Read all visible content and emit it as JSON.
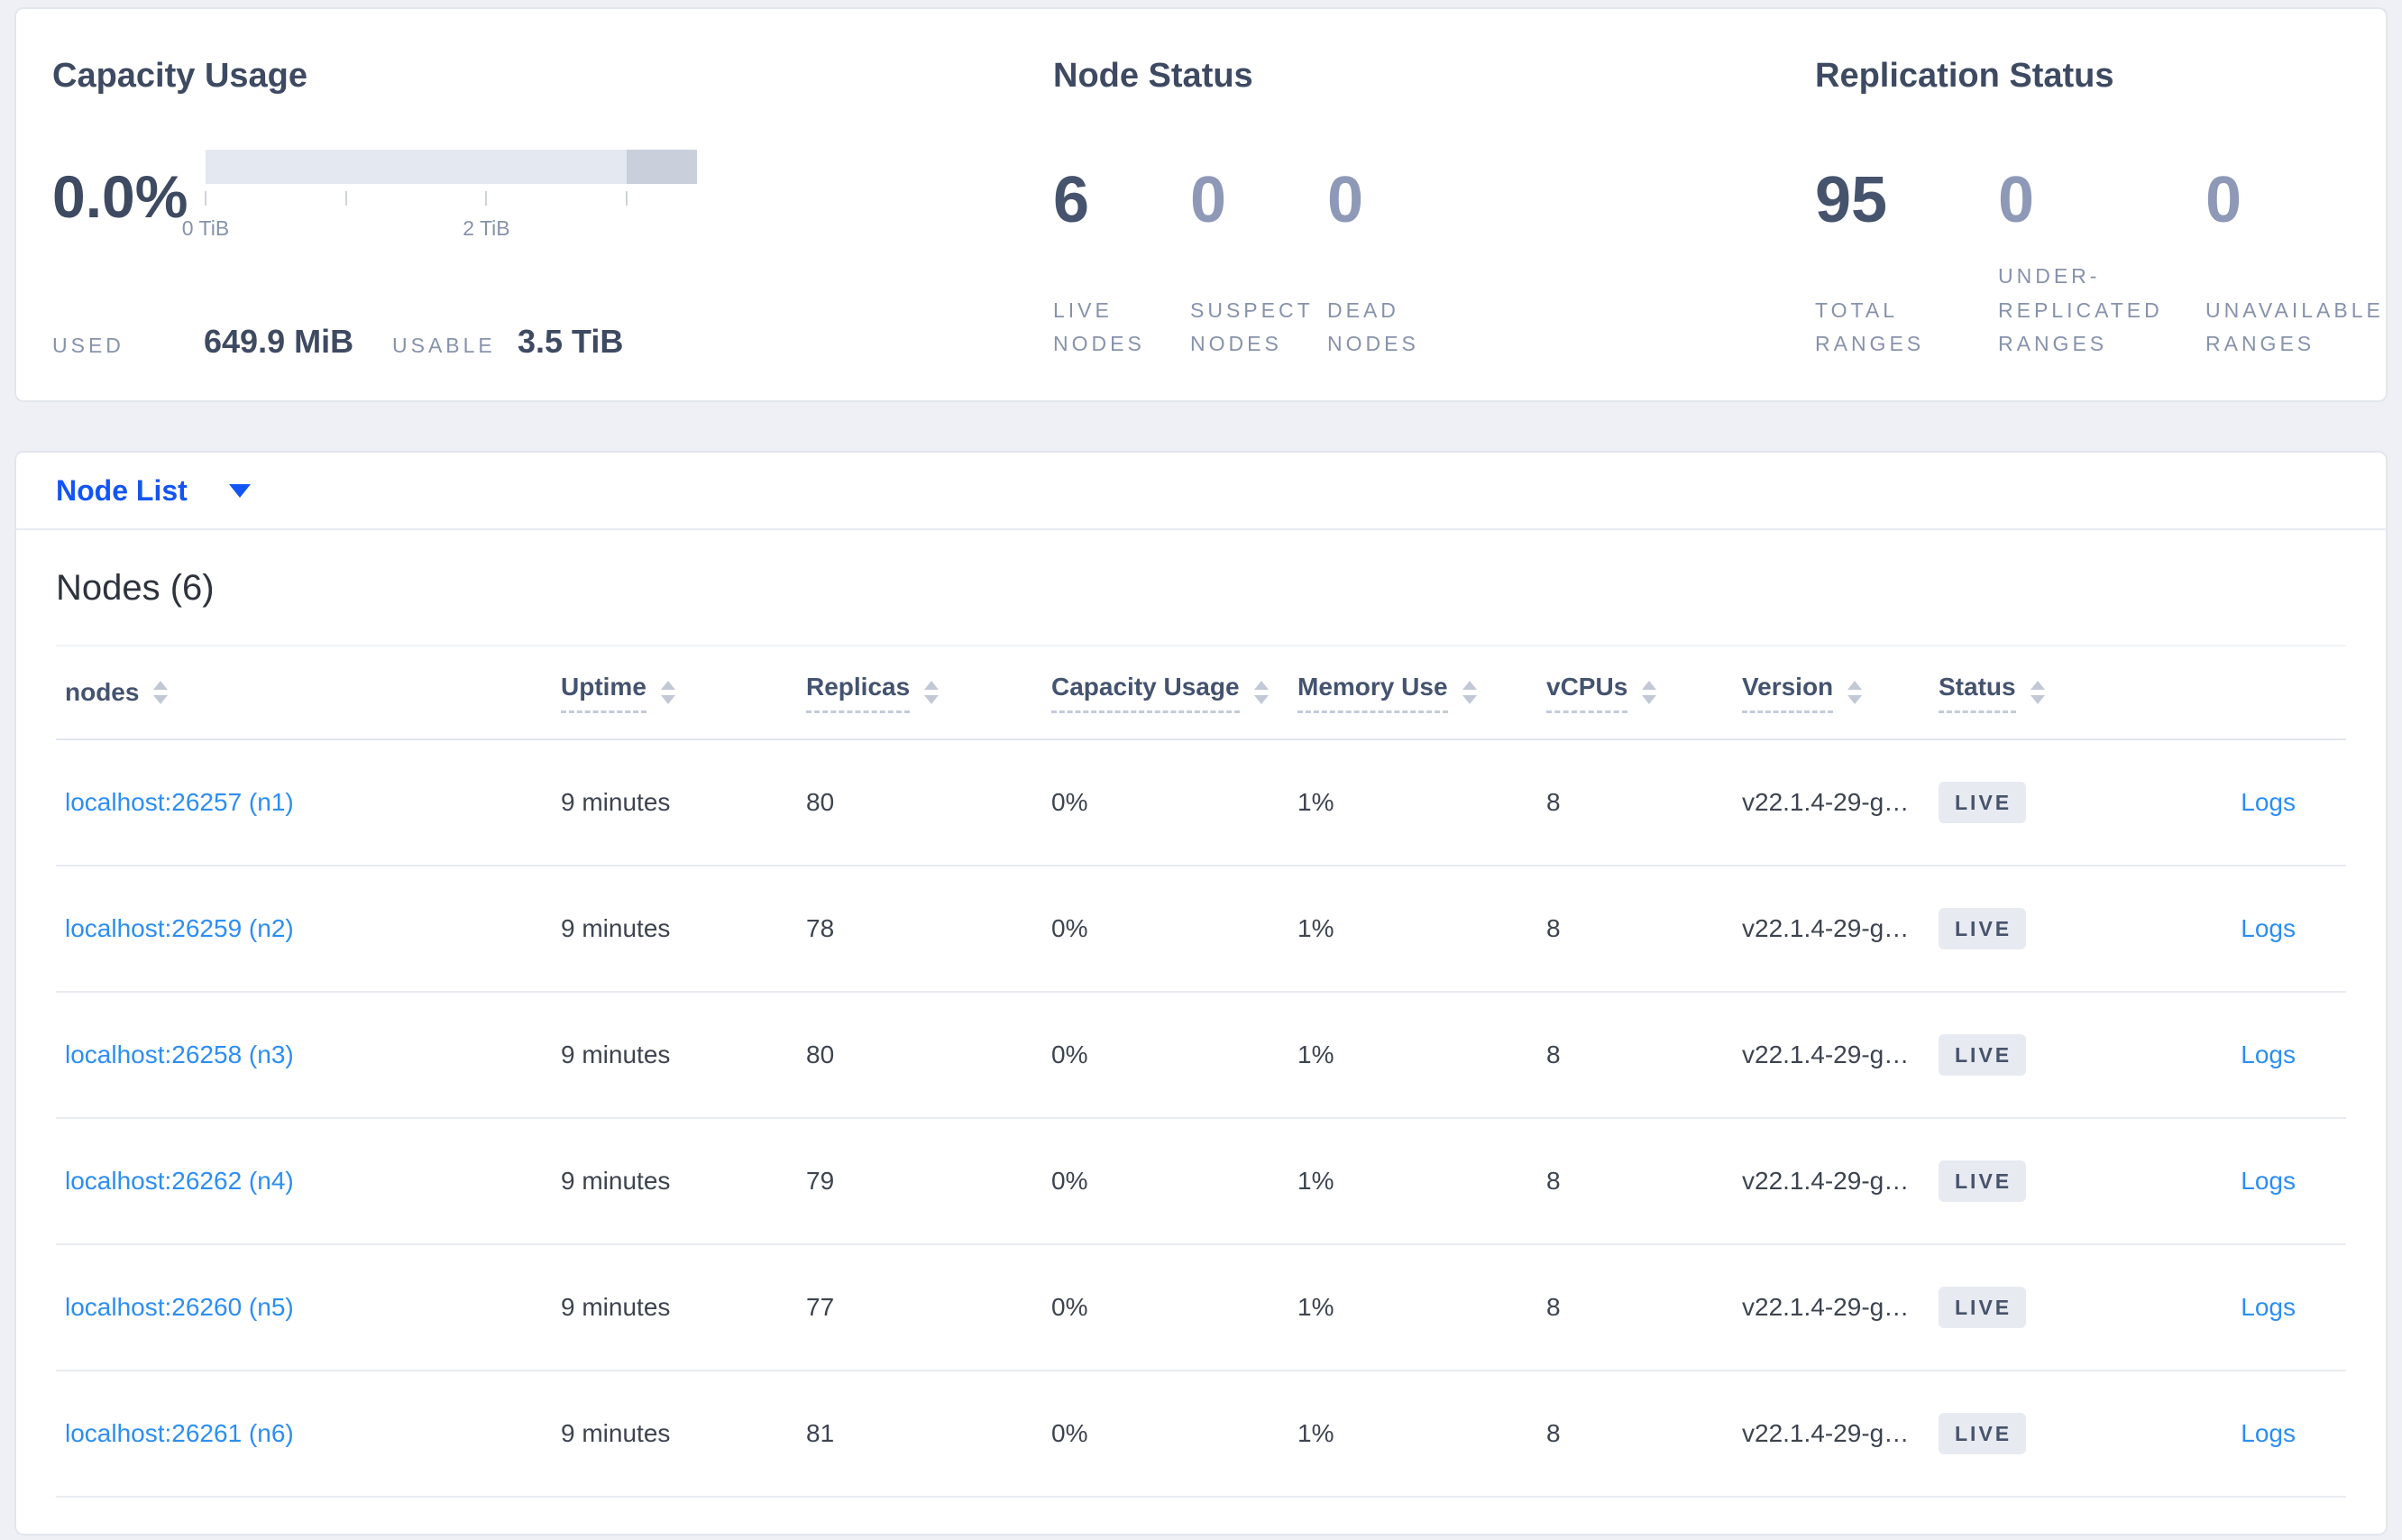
{
  "stats": {
    "capacity": {
      "title": "Capacity Usage",
      "percent_used": "0.0%",
      "gauge": {
        "total_tib": 3.5,
        "used_fraction_pct": 0,
        "secondary_start_pct": 85.7,
        "ticks": [
          {
            "label": "0 TiB",
            "tib": 0,
            "pct": 0
          },
          {
            "label": "",
            "tib": 1,
            "pct": 28.57
          },
          {
            "label": "2 TiB",
            "tib": 2,
            "pct": 57.14
          },
          {
            "label": "",
            "tib": 3,
            "pct": 85.71
          }
        ]
      },
      "used_label": "USED",
      "used_value": "649.9 MiB",
      "usable_label": "USABLE",
      "usable_value": "3.5 TiB"
    },
    "node_status": {
      "title": "Node Status",
      "metrics": [
        {
          "value": "6",
          "label": "LIVE NODES",
          "muted": false
        },
        {
          "value": "0",
          "label": "SUSPECT NODES",
          "muted": true
        },
        {
          "value": "0",
          "label": "DEAD NODES",
          "muted": true
        }
      ]
    },
    "replication": {
      "title": "Replication Status",
      "metrics": [
        {
          "value": "95",
          "label": "TOTAL RANGES",
          "muted": false
        },
        {
          "value": "0",
          "label": "UNDER-REPLICATED RANGES",
          "muted": true
        },
        {
          "value": "0",
          "label": "UNAVAILABLE RANGES",
          "muted": true
        }
      ]
    }
  },
  "view_selector": {
    "label": "Node List"
  },
  "node_table": {
    "title": "Nodes (6)",
    "logs_label": "Logs",
    "columns": [
      {
        "label": "nodes",
        "sortable": true,
        "dashed": false
      },
      {
        "label": "Uptime",
        "sortable": true,
        "dashed": true
      },
      {
        "label": "Replicas",
        "sortable": true,
        "dashed": true
      },
      {
        "label": "Capacity Usage",
        "sortable": true,
        "dashed": true
      },
      {
        "label": "Memory Use",
        "sortable": true,
        "dashed": true
      },
      {
        "label": "vCPUs",
        "sortable": true,
        "dashed": true
      },
      {
        "label": "Version",
        "sortable": true,
        "dashed": true
      },
      {
        "label": "Status",
        "sortable": true,
        "dashed": true
      },
      {
        "label": "",
        "sortable": false,
        "dashed": false
      }
    ],
    "rows": [
      {
        "node": "localhost:26257 (n1)",
        "uptime": "9 minutes",
        "replicas": "80",
        "capacity": "0%",
        "memory": "1%",
        "vcpus": "8",
        "version": "v22.1.4-29-g…",
        "status": "LIVE"
      },
      {
        "node": "localhost:26259 (n2)",
        "uptime": "9 minutes",
        "replicas": "78",
        "capacity": "0%",
        "memory": "1%",
        "vcpus": "8",
        "version": "v22.1.4-29-g…",
        "status": "LIVE"
      },
      {
        "node": "localhost:26258 (n3)",
        "uptime": "9 minutes",
        "replicas": "80",
        "capacity": "0%",
        "memory": "1%",
        "vcpus": "8",
        "version": "v22.1.4-29-g…",
        "status": "LIVE"
      },
      {
        "node": "localhost:26262 (n4)",
        "uptime": "9 minutes",
        "replicas": "79",
        "capacity": "0%",
        "memory": "1%",
        "vcpus": "8",
        "version": "v22.1.4-29-g…",
        "status": "LIVE"
      },
      {
        "node": "localhost:26260 (n5)",
        "uptime": "9 minutes",
        "replicas": "77",
        "capacity": "0%",
        "memory": "1%",
        "vcpus": "8",
        "version": "v22.1.4-29-g…",
        "status": "LIVE"
      },
      {
        "node": "localhost:26261 (n6)",
        "uptime": "9 minutes",
        "replicas": "81",
        "capacity": "0%",
        "memory": "1%",
        "vcpus": "8",
        "version": "v22.1.4-29-g…",
        "status": "LIVE"
      }
    ]
  },
  "colors": {
    "accent_blue": "#1355f4",
    "link_blue": "#2c8ef2",
    "metric_dark": "#46536d",
    "metric_muted": "#8e99b8",
    "badge_bg": "#e7eaf1",
    "gauge_track": "#e4e8f0",
    "gauge_secondary": "#c9cfdb",
    "page_bg": "#eef0f5"
  }
}
